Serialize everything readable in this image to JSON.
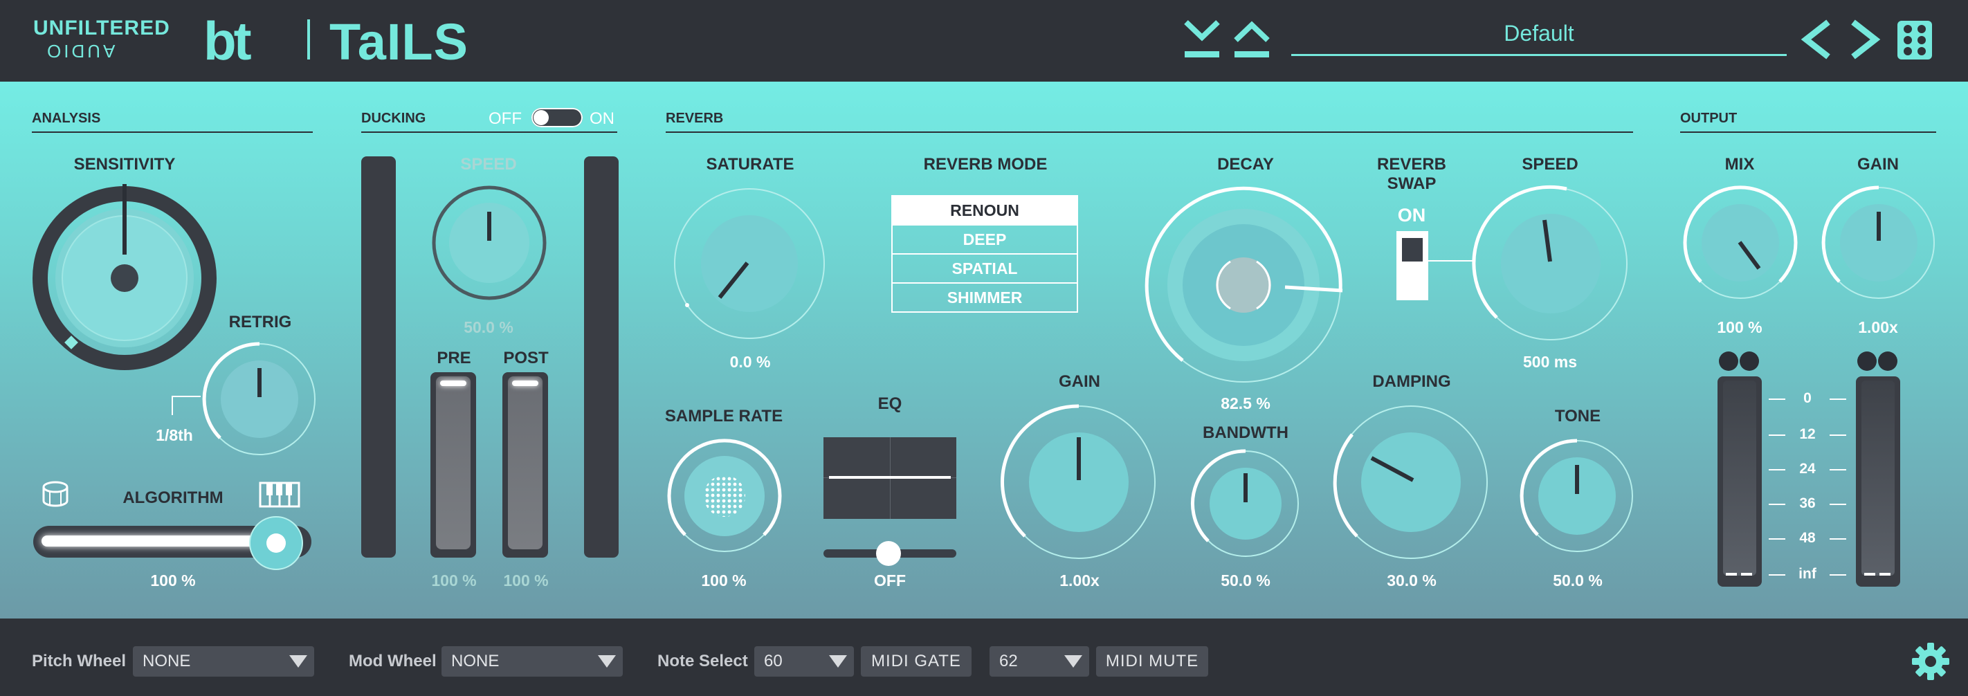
{
  "header": {
    "brand_top": "UNFILTERED",
    "brand_bottom": "AUDIO",
    "brand_bt": "bt",
    "product": "TaILS",
    "preset_name": "Default",
    "icons": [
      "save-download-icon",
      "load-upload-icon",
      "previous-preset-icon",
      "next-preset-icon",
      "preset-grid-icon"
    ]
  },
  "analysis": {
    "title": "ANALYSIS",
    "sensitivity_label": "SENSITIVITY",
    "retrig_label": "RETRIG",
    "retrig_value": "1/8th",
    "algorithm_label": "ALGORITHM",
    "algorithm_value": "100 %",
    "algorithm_level": 1.0
  },
  "ducking": {
    "title": "DUCKING",
    "toggle_off": "OFF",
    "toggle_on": "ON",
    "speed_label": "SPEED",
    "speed_value": "50.0 %",
    "pre_label": "PRE",
    "post_label": "POST",
    "pre_value": "100 %",
    "post_value": "100 %"
  },
  "reverb": {
    "title": "REVERB",
    "saturate_label": "SATURATE",
    "saturate_value": "0.0 %",
    "mode_label": "REVERB MODE",
    "modes": [
      "RENOUN",
      "DEEP",
      "SPATIAL",
      "SHIMMER"
    ],
    "selected_mode": "RENOUN",
    "decay_label": "DECAY",
    "decay_value": "82.5 %",
    "swap_label_1": "REVERB",
    "swap_label_2": "SWAP",
    "swap_state": "ON",
    "speed_label": "SPEED",
    "speed_value": "500 ms",
    "sample_rate_label": "SAMPLE RATE",
    "sample_rate_value": "100 %",
    "eq_label": "EQ",
    "eq_value": "OFF",
    "gain_label": "GAIN",
    "gain_value": "1.00x",
    "bandwidth_label": "BANDWTH",
    "bandwidth_value": "50.0 %",
    "damping_label": "DAMPING",
    "damping_value": "30.0 %",
    "tone_label": "TONE",
    "tone_value": "50.0 %"
  },
  "output": {
    "title": "OUTPUT",
    "mix_label": "MIX",
    "mix_value": "100 %",
    "gain_label": "GAIN",
    "gain_value": "1.00x",
    "scale": [
      "0",
      "12",
      "24",
      "36",
      "48",
      "inf"
    ]
  },
  "bottom": {
    "pitch_wheel_label": "Pitch Wheel",
    "pitch_wheel_value": "NONE",
    "mod_wheel_label": "Mod Wheel",
    "mod_wheel_value": "NONE",
    "note_select_label": "Note Select",
    "note_gate_value": "60",
    "midi_gate_label": "MIDI GATE",
    "note_mute_value": "62",
    "midi_mute_label": "MIDI MUTE"
  },
  "colors": {
    "accent": "#75e8dc",
    "dark": "#2f3238",
    "panel_top": "#74ece4",
    "panel_bottom": "#6c9aa7"
  }
}
